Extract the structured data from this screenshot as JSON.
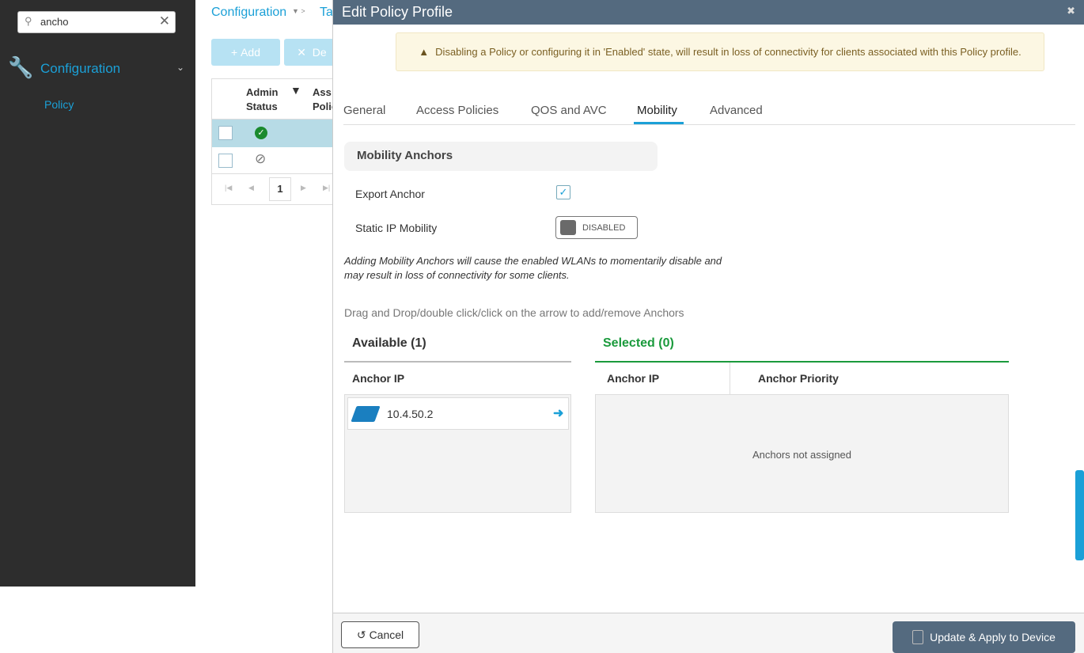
{
  "sidebar": {
    "search_value": "ancho",
    "section": "Configuration",
    "item": "Policy"
  },
  "background": {
    "breadcrumb": "Configuration",
    "breadcrumb_next": "Ta",
    "add_label": "Add",
    "delete_label": "De",
    "col_admin_status": "Admin Status",
    "col_assoc": "Ass Polic",
    "page": "1"
  },
  "modal": {
    "title": "Edit Policy Profile",
    "warning": "Disabling a Policy or configuring it in 'Enabled' state, will result in loss of connectivity for clients associated with this Policy profile.",
    "tabs": [
      "General",
      "Access Policies",
      "QOS and AVC",
      "Mobility",
      "Advanced"
    ],
    "active_tab": "Mobility",
    "section_title": "Mobility Anchors",
    "export_anchor_label": "Export Anchor",
    "export_anchor_checked": true,
    "static_ip_label": "Static IP Mobility",
    "static_ip_state": "DISABLED",
    "note": "Adding Mobility Anchors will cause the enabled WLANs to momentarily disable and may result in loss of connectivity for some clients.",
    "instructions": "Drag and Drop/double click/click on the arrow to add/remove Anchors",
    "available_title": "Available (1)",
    "selected_title": "Selected (0)",
    "available_col": "Anchor IP",
    "selected_cols": [
      "Anchor IP",
      "Anchor Priority"
    ],
    "available_items": [
      "10.4.50.2"
    ],
    "empty_text": "Anchors not assigned",
    "cancel_label": "Cancel",
    "apply_label": "Update & Apply to Device"
  },
  "colors": {
    "header": "#546a7f",
    "accent": "#1ba0d7",
    "selected_green": "#1a9a3c"
  }
}
